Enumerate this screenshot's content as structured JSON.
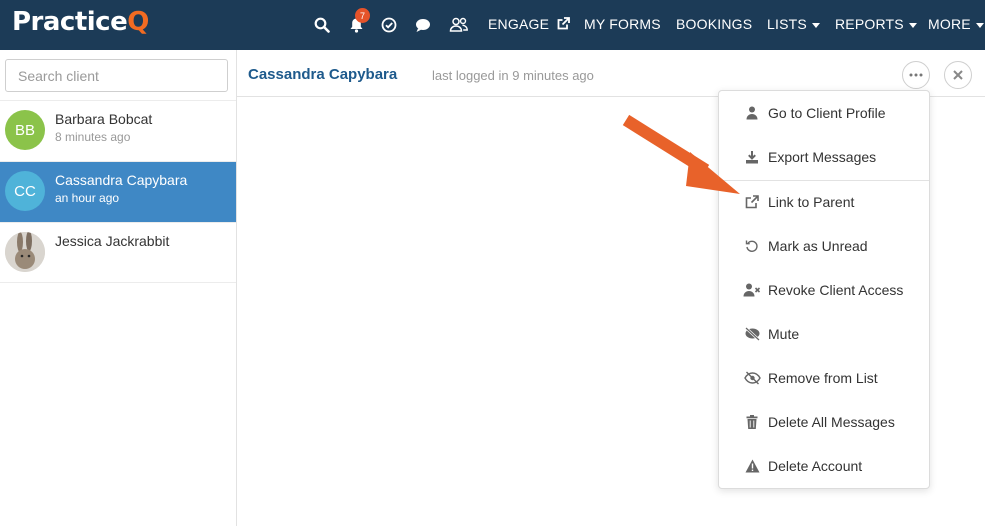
{
  "app": {
    "logo_main": "Practice",
    "logo_accent": "Q"
  },
  "nav": {
    "notification_count": "7",
    "links": [
      {
        "label": "ENGAGE"
      },
      {
        "label": "MY FORMS"
      },
      {
        "label": "BOOKINGS"
      },
      {
        "label": "LISTS"
      },
      {
        "label": "REPORTS"
      },
      {
        "label": "MORE"
      }
    ]
  },
  "sidebar": {
    "search_placeholder": "Search client",
    "clients": [
      {
        "initials": "BB",
        "name": "Barbara Bobcat",
        "time": "8 minutes ago",
        "color": "#8bc34a"
      },
      {
        "initials": "CC",
        "name": "Cassandra Capybara",
        "time": "an hour ago",
        "color": "#4fb3d9"
      },
      {
        "initials": "",
        "name": "Jessica Jackrabbit",
        "time": "",
        "color": "#a89c8e"
      }
    ]
  },
  "conversation": {
    "client_name": "Cassandra Capybara",
    "status": "last logged in 9 minutes ago"
  },
  "menu": {
    "items": [
      {
        "label": "Go to Client Profile",
        "icon": "user-icon"
      },
      {
        "label": "Export Messages",
        "icon": "download-icon"
      },
      {
        "label": "Link to Parent",
        "icon": "external-link-icon"
      },
      {
        "label": "Mark as Unread",
        "icon": "undo-icon"
      },
      {
        "label": "Revoke Client Access",
        "icon": "user-times-icon"
      },
      {
        "label": "Mute",
        "icon": "mute-icon"
      },
      {
        "label": "Remove from List",
        "icon": "eye-slash-icon"
      },
      {
        "label": "Delete All Messages",
        "icon": "trash-icon"
      },
      {
        "label": "Delete Account",
        "icon": "warning-icon"
      }
    ]
  },
  "colors": {
    "topbar": "#1c3b57",
    "accent": "#f26b22",
    "active_row": "#3f88c5",
    "header_name": "#1e5a8c",
    "annotation_arrow": "#e8622a"
  }
}
